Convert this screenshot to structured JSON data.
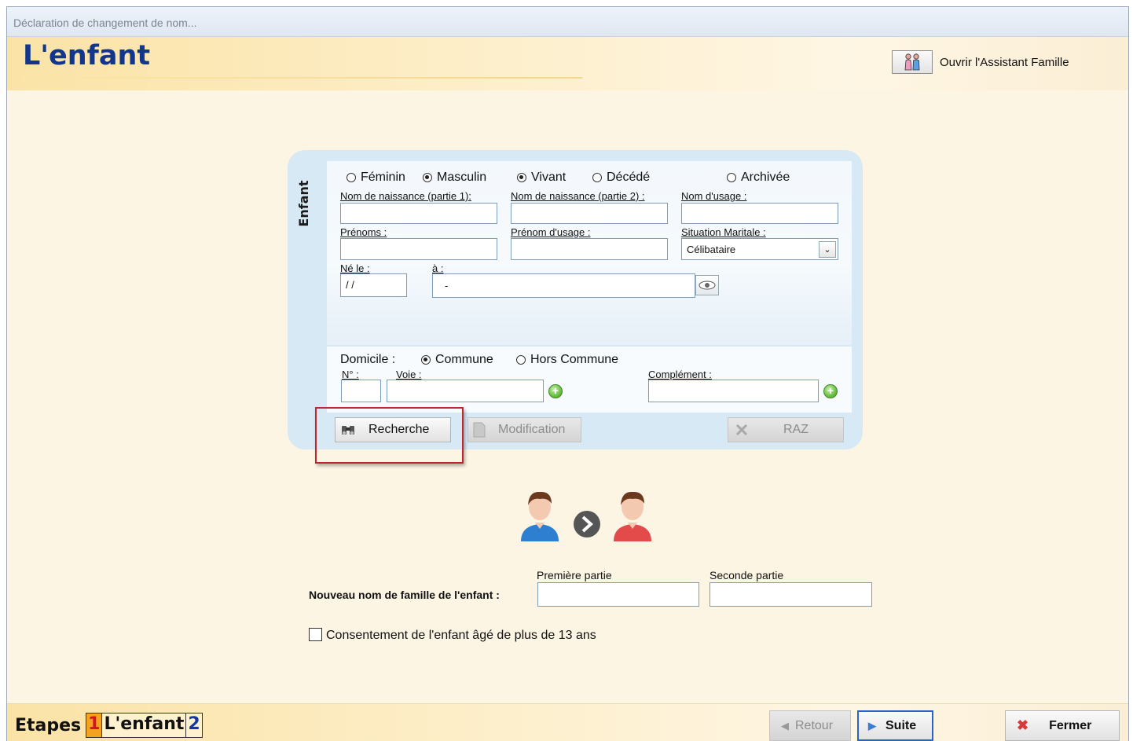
{
  "window": {
    "title": "Déclaration de changement de nom..."
  },
  "header": {
    "page_title": "L'enfant",
    "assistant_label": "Ouvrir l'Assistant Famille",
    "assistant_icon": "family-icon"
  },
  "panel": {
    "section_label": "Enfant",
    "sex": {
      "options": [
        "Féminin",
        "Masculin"
      ],
      "selected": "Masculin"
    },
    "status": {
      "options": [
        "Vivant",
        "Décédé"
      ],
      "selected": "Vivant"
    },
    "archived": {
      "label": "Archivée",
      "checked": false
    },
    "fields": {
      "nom_naissance_1": {
        "label": "Nom de naissance (partie 1):",
        "value": ""
      },
      "nom_naissance_2": {
        "label": "Nom de naissance (partie 2) :",
        "value": ""
      },
      "nom_usage": {
        "label": "Nom d'usage :",
        "value": ""
      },
      "prenoms": {
        "label": "Prénoms :",
        "value": ""
      },
      "prenom_usage": {
        "label": "Prénom d'usage :",
        "value": ""
      },
      "situation_maritale": {
        "label": "Situation Maritale :",
        "value": "Célibataire"
      },
      "ne_le": {
        "label": "Né le :",
        "value": " / /"
      },
      "a": {
        "label": "à :",
        "value": "-"
      }
    },
    "domicile": {
      "label": "Domicile :",
      "options": [
        "Commune",
        "Hors Commune"
      ],
      "selected": "Commune",
      "numero_label": "N° :",
      "voie_label": "Voie :",
      "complement_label": "Complément :"
    },
    "buttons": {
      "recherche": "Recherche",
      "modification": "Modification",
      "raz": "RAZ"
    }
  },
  "new_name": {
    "label": "Nouveau nom de famille de l'enfant :",
    "first_part_label": "Première partie",
    "second_part_label": "Seconde partie",
    "first_value": "",
    "second_value": ""
  },
  "consent": {
    "label": "Consentement de l'enfant âgé de plus de 13 ans",
    "checked": false
  },
  "footer": {
    "steps_label": "Etapes",
    "current_step": "1",
    "current_step_name": "L'enfant",
    "next_step": "2",
    "retour": "Retour",
    "suite": "Suite",
    "fermer": "Fermer"
  },
  "colors": {
    "title_blue": "#12368c",
    "panel_blue": "#d8e9f6",
    "highlight_red": "#c0262c",
    "header_gold": "#fbe3a6"
  }
}
